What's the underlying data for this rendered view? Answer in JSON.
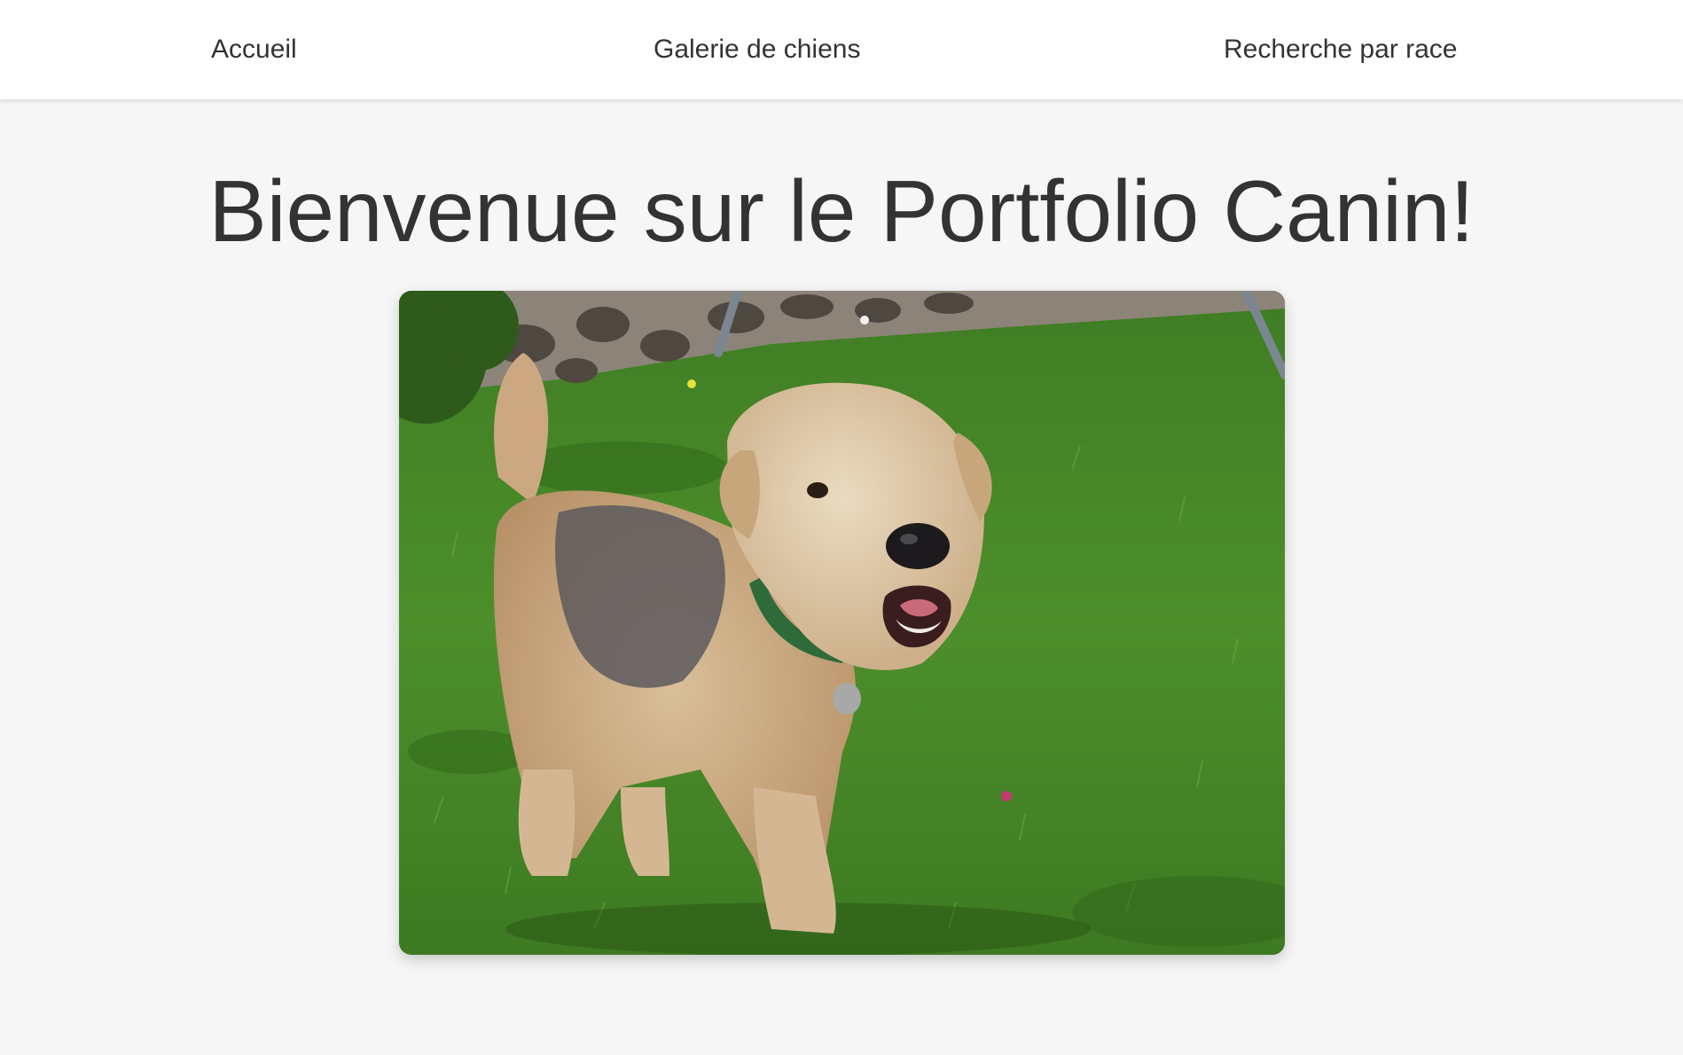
{
  "nav": {
    "items": [
      {
        "label": "Accueil"
      },
      {
        "label": "Galerie de chiens"
      },
      {
        "label": "Recherche par race"
      }
    ]
  },
  "main": {
    "title": "Bienvenue sur le Portfolio Canin!",
    "image": {
      "subject": "curly-haired terrier dog standing on grass in a garden"
    }
  },
  "colors": {
    "page_background": "#f6f6f6",
    "navbar_background": "#ffffff",
    "text": "#333333"
  }
}
